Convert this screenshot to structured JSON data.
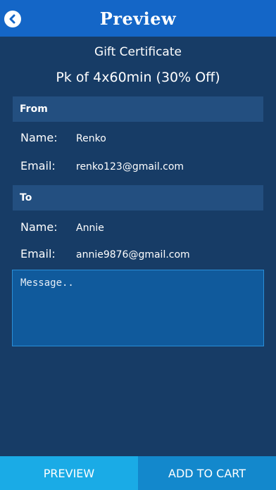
{
  "header": {
    "title": "Preview",
    "back_icon": "chevron-left-circle-icon"
  },
  "certificate": {
    "type": "Gift Certificate",
    "package": "Pk of 4x60min (30% Off)"
  },
  "from": {
    "heading": "From",
    "name_label": "Name:",
    "name_value": "Renko",
    "email_label": "Email:",
    "email_value": "renko123@gmail.com"
  },
  "to": {
    "heading": "To",
    "name_label": "Name:",
    "name_value": "Annie",
    "email_label": "Email:",
    "email_value": "annie9876@gmail.com"
  },
  "message": {
    "value": "",
    "placeholder": "Message.."
  },
  "footer": {
    "preview_label": "PREVIEW",
    "add_to_cart_label": "ADD TO CART"
  },
  "colors": {
    "header": "#1466c7",
    "background": "#173c66",
    "section": "#234f80",
    "preview_button": "#1aabe6",
    "cart_button": "#1388cc"
  }
}
